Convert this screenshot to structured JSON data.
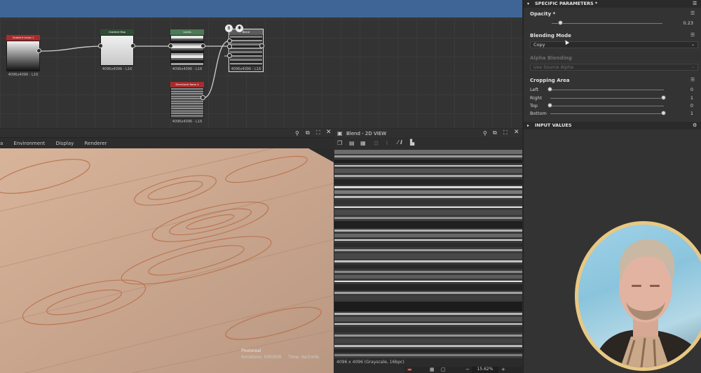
{
  "graph": {
    "nodes": [
      {
        "id": "n1",
        "header": "Gradient Linear 1",
        "caption": "4096x4096 - L16",
        "header_color": "#a92c2c"
      },
      {
        "id": "n2",
        "header": "Gradient Map",
        "caption": "4096x4096 - L16",
        "header_color": "#2f4d33"
      },
      {
        "id": "n3",
        "header": "Levels",
        "caption": "4096x4096 - L16",
        "header_color": "#4c7a57"
      },
      {
        "id": "n4",
        "header": "Blend",
        "caption": "4096x4096 - L16",
        "header_color": "#5c5c5c"
      },
      {
        "id": "n5",
        "header": "Directional Noise 4",
        "caption": "4096x4096 - L16",
        "header_color": "#a92c2c"
      }
    ]
  },
  "view3d": {
    "menu": [
      "a",
      "Environment",
      "Display",
      "Renderer"
    ],
    "render_mode": "Photoreal",
    "iterations": "Iterations: 500/500",
    "time": "Time: 4s/1m0s"
  },
  "view2d": {
    "title": "Blend - 2D VIEW",
    "status": "4096 x 4096 (Grayscale, 16bpc)",
    "zoom": "15.62%"
  },
  "panel": {
    "specific_title": "SPECIFIC PARAMETERS *",
    "opacity_label": "Opacity *",
    "opacity_value": "0.23",
    "opacity": 0.23,
    "blending_label": "Blending Mode",
    "blending_value": "Copy",
    "alpha_label": "Alpha Blending",
    "alpha_value": "Use Source Alpha",
    "cropping_label": "Cropping Area",
    "crop": [
      {
        "label": "Left",
        "value": "0",
        "fraction": 0
      },
      {
        "label": "Right",
        "value": "1",
        "fraction": 1
      },
      {
        "label": "Top",
        "value": "0",
        "fraction": 0
      },
      {
        "label": "Bottom",
        "value": "1",
        "fraction": 1
      }
    ],
    "input_title": "INPUT VALUES"
  },
  "colors": {
    "topbar": "#3f6596",
    "webcam_border": "#e8c882"
  }
}
